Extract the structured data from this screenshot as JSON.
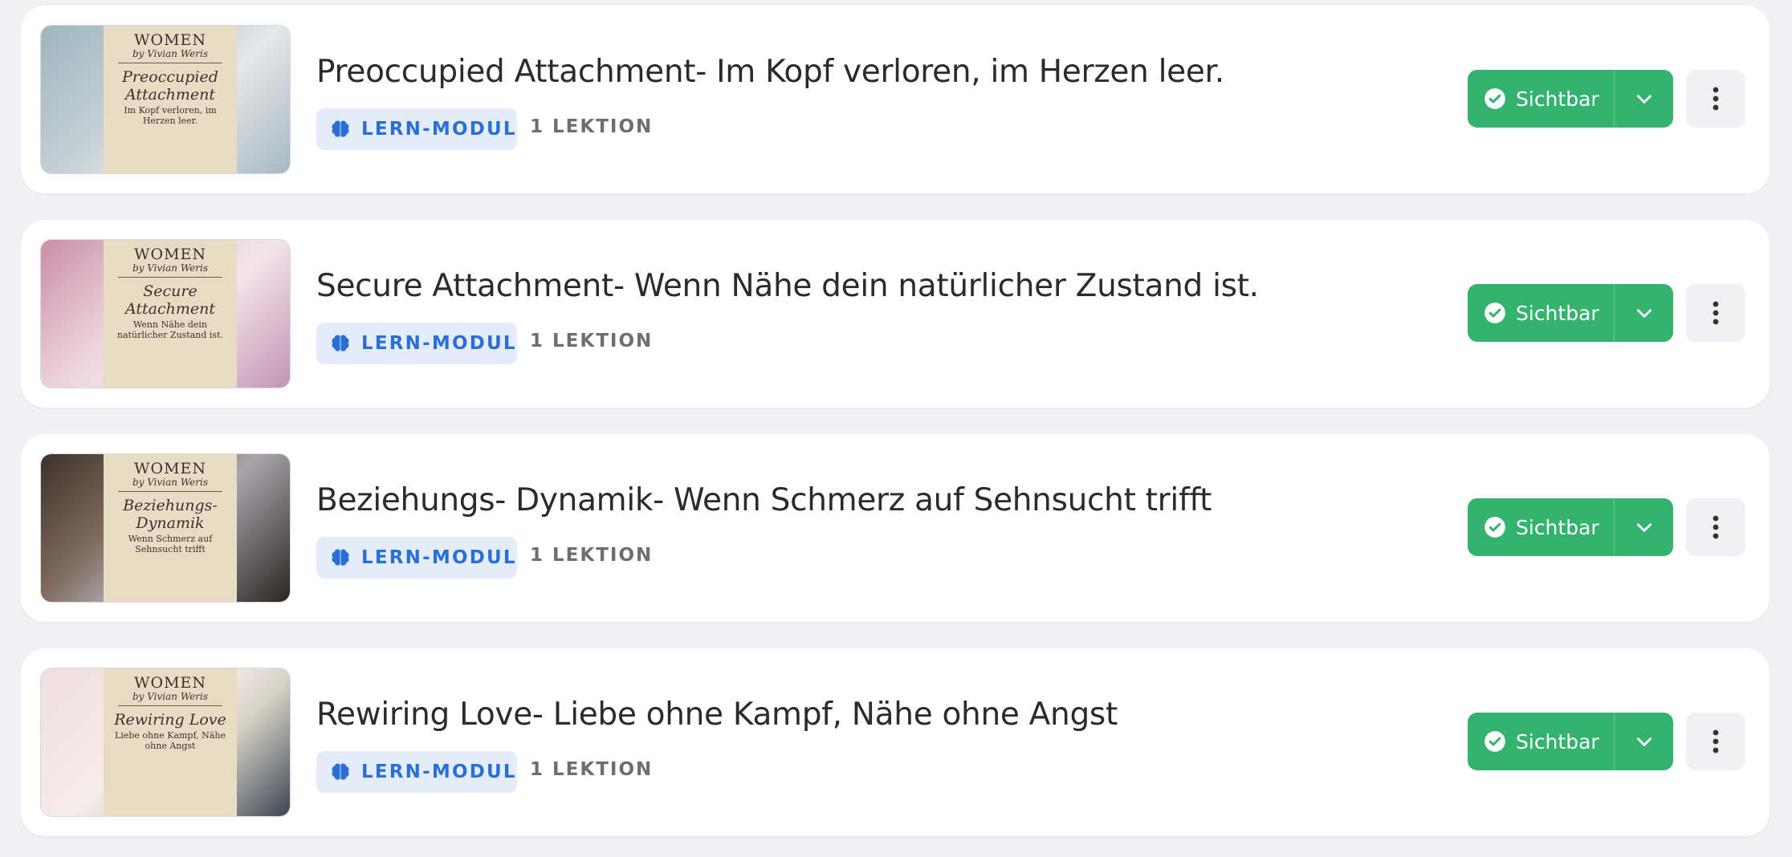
{
  "colors": {
    "accent_green": "#33b36e",
    "badge_bg": "#e4ecfa",
    "badge_text": "#2a6fd6"
  },
  "modules": [
    {
      "title": "Preoccupied Attachment- Im Kopf verloren,  im Herzen leer.",
      "badge": "LERN-MODUL",
      "lessons": "1 LEKTION",
      "status": "Sichtbar",
      "thumb": {
        "brand": "WOMEN",
        "byline": "by Vivian Weris",
        "script": "Preoccupied Attachment",
        "sub": "Im Kopf verloren, im Herzen leer."
      }
    },
    {
      "title": "Secure Attachment- Wenn Nähe dein natürlicher Zustand ist.",
      "badge": "LERN-MODUL",
      "lessons": "1 LEKTION",
      "status": "Sichtbar",
      "thumb": {
        "brand": "WOMEN",
        "byline": "by Vivian Weris",
        "script": "Secure Attachment",
        "sub": "Wenn Nähe dein natürlicher Zustand ist."
      }
    },
    {
      "title": "Beziehungs- Dynamik- Wenn Schmerz  auf Sehnsucht trifft",
      "badge": "LERN-MODUL",
      "lessons": "1 LEKTION",
      "status": "Sichtbar",
      "thumb": {
        "brand": "WOMEN",
        "byline": "by Vivian Weris",
        "script": "Beziehungs- Dynamik",
        "sub": "Wenn Schmerz auf Sehnsucht trifft"
      }
    },
    {
      "title": "Rewiring Love- Liebe ohne Kampf,  Nähe ohne Angst",
      "badge": "LERN-MODUL",
      "lessons": "1 LEKTION",
      "status": "Sichtbar",
      "thumb": {
        "brand": "WOMEN",
        "byline": "by Vivian Weris",
        "script": "Rewiring Love",
        "sub": "Liebe ohne Kampf, Nähe ohne Angst"
      }
    }
  ]
}
